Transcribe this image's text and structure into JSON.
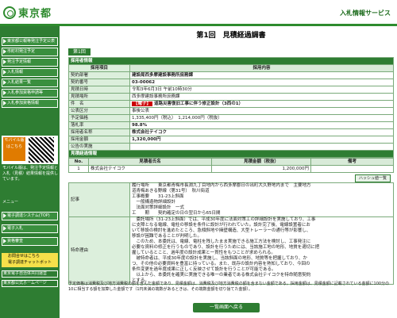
{
  "header": {
    "logo_text": "東京都",
    "service_title": "入札情報サービス"
  },
  "sidebar": {
    "items": [
      {
        "label": "東京都公報等発注予定公表"
      },
      {
        "label": "市町村発注予定"
      },
      {
        "label": "発注予定情報"
      },
      {
        "label": "入札情報"
      },
      {
        "label": "入札結果一覧"
      },
      {
        "label": "入札参加資格申請等"
      },
      {
        "label": "入札参加資格情報"
      }
    ],
    "mobile_label": "モバイル版",
    "mobile_sub": "はこちら",
    "mobile_note": "モバイル版は、発注予定情報と入札（見積）結果情報を提供しています。",
    "label_menu": "メニュー",
    "bottom_items": [
      {
        "label": "電子調達システム(TOP)"
      },
      {
        "label": "電子入札"
      },
      {
        "label": "資格審査"
      }
    ],
    "callcenter": "お問合せはこちら",
    "callcenter_sub": "電子調達チャットボット",
    "links": [
      {
        "label": "東京電子自治体共同運営"
      },
      {
        "label": "東京都公式ホームページ"
      }
    ]
  },
  "page": {
    "title": "第1回　見積経過調書",
    "round_chip": "第1回"
  },
  "procurement": {
    "section_title": "採用者情報",
    "col_item": "採用項目",
    "col_content": "採用内容",
    "rows": [
      {
        "label": "契約部署",
        "value": "建設局西多摩建設事務所庶務課",
        "bold": true
      },
      {
        "label": "契約番号",
        "value": "03-00062",
        "bold": true
      },
      {
        "label": "見積日時",
        "value": "令和3年6月3日 午前10時30分",
        "bold": false
      },
      {
        "label": "見積場所",
        "value": "西多摩建設事務所庶務課",
        "bold": false
      },
      {
        "label": "件　名",
        "tag": "【電子】",
        "value": "道路災害復旧工事に伴う修正設計（3西の1）",
        "bold": true
      },
      {
        "label": "公表区分",
        "value": "事後公表",
        "bold": false
      },
      {
        "label": "予定価格",
        "value": "1,335,400円（税込）　1,214,000円（税抜）",
        "bold": false
      },
      {
        "label": "落札率",
        "value": "98.8%",
        "bold": true
      },
      {
        "label": "採用者名称",
        "value": "株式会社テイコク",
        "bold": true
      },
      {
        "label": "採用金額",
        "value": "1,320,000円",
        "bold": true
      },
      {
        "label": "公告の実施",
        "value": "",
        "bold": false
      }
    ]
  },
  "estimates": {
    "section_title": "見積経過情報",
    "col_no": "No.",
    "col_name": "見積者氏名",
    "col_amount": "見積金額（税抜）",
    "col_note": "備考",
    "rows": [
      {
        "no": "1",
        "name": "株式会社テイコク",
        "amount": "1,200,000円",
        "note": ""
      }
    ],
    "hs_button": "ハッシュ値一覧"
  },
  "memo": {
    "label": "記事",
    "lines": [
      "履行場所　　東京都青梅市長淵九丁目地内から西多摩郡日の出町大久野地内まで　主要地方",
      "道青梅あきる野線（第31号）　秋川街道",
      "工事概要　　31-23上斜面",
      "　一般構造物詳細設計",
      "　法面対策詳細設計　一式",
      "工　　期　　契約確定の日の翌日から65日間"
    ]
  },
  "reason": {
    "label": "特命理由",
    "lines": [
      "　委託場所（31-23上斜面）では、平成30年度に法面対策工の詳細設計を実施しており、工事",
      "に支障となる電線、電柱の移設を条件に設計が行われていた。設計完了後、電線設置者にお",
      "いて移設の検討を進めたところ、急傾斜地や擁壁構造、大型トレーラーの通行等が影響し、",
      "移設が困難であることが判明した。",
      "　このため、本委託は、電線、電柱を残したまま実施できる施工方法を検討し、工事発注に",
      "必要な資料の修正を行うものであり、設計を行うためには、当該施工地の地形、地質を適切に把",
      "握しているとこと、過年度の設計成果と一貫性をもつことが求められる。",
      "　被特命者は、平成30年度の設計を実施し、当該斜面の地形、地質等を把握しており、か",
      "つ、その他の必要資料を豊富に持っている。また、既存の設計内容を熟知しており、今回の",
      "条件変更を過年度成果に正しく反映させて設計を行うことが可能である。",
      "　以上から、本委託を確実に実施できる唯一の業者である株式会社テイコクを特命随意契約",
      "とする。"
    ]
  },
  "footnote": "予定価格は消費税及び地方消費税の額を含んだ金額であり、見積金額は、消費税及び地方消費税の額を含まない金額である。採用金額は、見積金額に記載されている金額に100分の10に相当する額を加算した金額です（1円未満の端数があるときは、その端数金額を切り捨てた金額）。",
  "back_button": "一覧画面へ戻る"
}
